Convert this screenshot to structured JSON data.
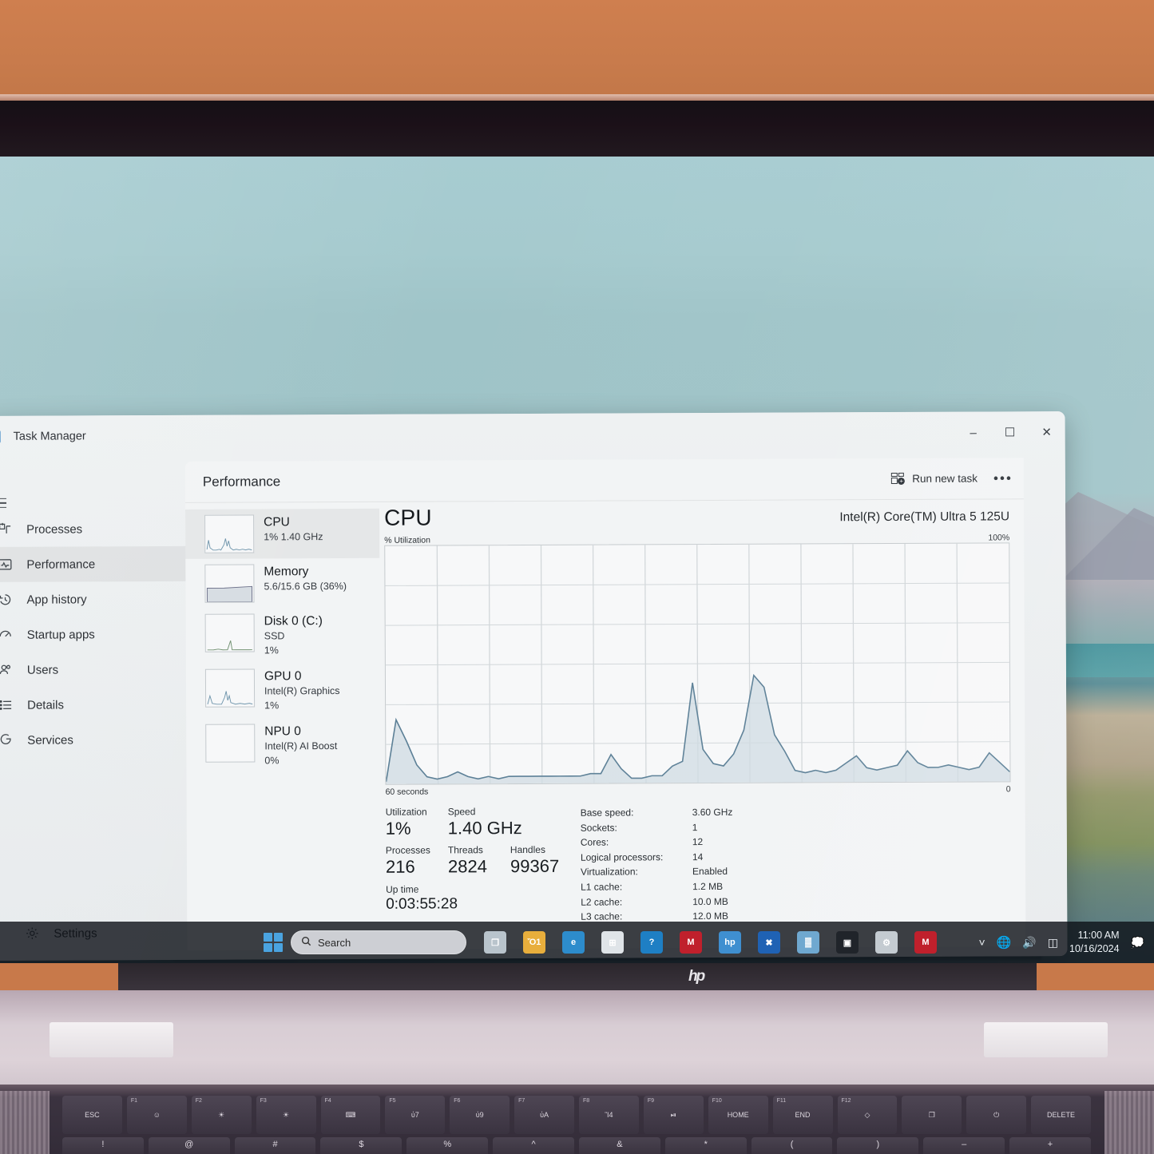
{
  "window": {
    "title": "Task Manager",
    "app_icon": "task-manager-icon",
    "minimize": "–",
    "maximize": "☐",
    "close": "✕"
  },
  "sidebar": {
    "hamburger": "menu-icon",
    "items": [
      {
        "label": "Processes",
        "icon": "processes-icon",
        "selected": false
      },
      {
        "label": "Performance",
        "icon": "performance-icon",
        "selected": true
      },
      {
        "label": "App history",
        "icon": "history-icon",
        "selected": false
      },
      {
        "label": "Startup apps",
        "icon": "startup-icon",
        "selected": false
      },
      {
        "label": "Users",
        "icon": "users-icon",
        "selected": false
      },
      {
        "label": "Details",
        "icon": "details-icon",
        "selected": false
      },
      {
        "label": "Services",
        "icon": "services-icon",
        "selected": false
      }
    ],
    "settings_label": "Settings",
    "settings_icon": "gear-icon"
  },
  "pane": {
    "title": "Performance",
    "run_new_task": "Run new task",
    "run_icon": "run-new-task-icon",
    "more_options": "•••"
  },
  "perf_list": [
    {
      "name": "CPU",
      "line1": "1%  1.40 GHz",
      "line2": "",
      "selected": true
    },
    {
      "name": "Memory",
      "line1": "5.6/15.6 GB (36%)",
      "line2": "",
      "selected": false
    },
    {
      "name": "Disk 0 (C:)",
      "line1": "SSD",
      "line2": "1%",
      "selected": false
    },
    {
      "name": "GPU 0",
      "line1": "Intel(R) Graphics",
      "line2": "1%",
      "selected": false
    },
    {
      "name": "NPU 0",
      "line1": "Intel(R) AI Boost",
      "line2": "0%",
      "selected": false
    }
  ],
  "detail": {
    "title": "CPU",
    "model": "Intel(R) Core(TM) Ultra 5 125U",
    "axis_y_label": "% Utilization",
    "axis_y_max": "100%",
    "axis_x_left": "60 seconds",
    "axis_x_right": "0",
    "stats": {
      "utilization_label": "Utilization",
      "utilization_value": "1%",
      "speed_label": "Speed",
      "speed_value": "1.40 GHz",
      "processes_label": "Processes",
      "processes_value": "216",
      "threads_label": "Threads",
      "threads_value": "2824",
      "handles_label": "Handles",
      "handles_value": "99367",
      "uptime_label": "Up time",
      "uptime_value": "0:03:55:28"
    },
    "specs": [
      {
        "key": "Base speed:",
        "value": "3.60 GHz"
      },
      {
        "key": "Sockets:",
        "value": "1"
      },
      {
        "key": "Cores:",
        "value": "12"
      },
      {
        "key": "Logical processors:",
        "value": "14"
      },
      {
        "key": "Virtualization:",
        "value": "Enabled"
      },
      {
        "key": "L1 cache:",
        "value": "1.2 MB"
      },
      {
        "key": "L2 cache:",
        "value": "10.0 MB"
      },
      {
        "key": "L3 cache:",
        "value": "12.0 MB"
      }
    ]
  },
  "chart_data": {
    "type": "area",
    "title": "CPU % Utilization",
    "xlabel": "60 seconds",
    "ylabel": "% Utilization",
    "ylim": [
      0,
      100
    ],
    "xlim": [
      60,
      0
    ],
    "grid": true,
    "legend": "none",
    "line_color": "#5b7f96",
    "fill_color": "#cfdbe2",
    "series": [
      {
        "name": "CPU utilization",
        "values": [
          1,
          27,
          18,
          8,
          3,
          2,
          3,
          5,
          3,
          2,
          3,
          2,
          3,
          3,
          3,
          3,
          3,
          3,
          3,
          3,
          4,
          4,
          12,
          6,
          2,
          2,
          3,
          3,
          7,
          9,
          42,
          14,
          8,
          7,
          12,
          22,
          45,
          40,
          20,
          13,
          5,
          4,
          5,
          4,
          5,
          8,
          11,
          6,
          5,
          6,
          7,
          13,
          8,
          6,
          6,
          7,
          6,
          5,
          6,
          12,
          8,
          4
        ]
      }
    ]
  },
  "taskbar": {
    "start_icon": "windows-start-icon",
    "search_icon": "search-icon",
    "search_placeholder": "Search",
    "icons": [
      {
        "name": "task-view-icon",
        "glyph": "❐",
        "color": "#b9c4cc"
      },
      {
        "name": "file-explorer-icon",
        "glyph": "Ὄ1",
        "color": "#e8ae3c"
      },
      {
        "name": "microsoft-edge-icon",
        "glyph": "e",
        "color": "#2d8ccc"
      },
      {
        "name": "microsoft-store-icon",
        "glyph": "⊞",
        "color": "#dfe4e8"
      },
      {
        "name": "help-icon",
        "glyph": "?",
        "color": "#1e7fc4"
      },
      {
        "name": "mcafee-icon",
        "glyph": "M",
        "color": "#c0202c"
      },
      {
        "name": "hp-app-icon",
        "glyph": "hp",
        "color": "#3f8fd0"
      },
      {
        "name": "hp-support-icon",
        "glyph": "✖",
        "color": "#1f62b4"
      },
      {
        "name": "task-manager-icon",
        "glyph": "▓",
        "color": "#6fa8d0"
      },
      {
        "name": "terminal-icon",
        "glyph": "▣",
        "color": "#20242a"
      },
      {
        "name": "settings-icon",
        "glyph": "⚙",
        "color": "#c4cbd1"
      },
      {
        "name": "mcafee-tray-icon",
        "glyph": "M",
        "color": "#c0202c"
      }
    ],
    "tray": [
      {
        "name": "show-hidden-icons",
        "glyph": "˄"
      },
      {
        "name": "network-icon",
        "glyph": "⊕"
      },
      {
        "name": "volume-icon",
        "glyph": "ὐA"
      },
      {
        "name": "battery-icon",
        "glyph": "▭"
      }
    ],
    "clock_time": "11:00 AM",
    "clock_date": "10/16/2024",
    "notification_icon": "notification-icon"
  },
  "laptop": {
    "brand": "hp",
    "fn_keys": [
      {
        "fn": "",
        "lbl": "ESC"
      },
      {
        "fn": "F1",
        "lbl": "☺"
      },
      {
        "fn": "F2",
        "lbl": "☀"
      },
      {
        "fn": "F3",
        "lbl": "☀"
      },
      {
        "fn": "F4",
        "lbl": "⌨"
      },
      {
        "fn": "F5",
        "lbl": "ὐ7"
      },
      {
        "fn": "F6",
        "lbl": "ὐ9"
      },
      {
        "fn": "F7",
        "lbl": "ὐA"
      },
      {
        "fn": "F8",
        "lbl": "Ἲ4"
      },
      {
        "fn": "F9",
        "lbl": "⏯"
      },
      {
        "fn": "F10",
        "lbl": "HOME"
      },
      {
        "fn": "F11",
        "lbl": "END"
      },
      {
        "fn": "F12",
        "lbl": "◇"
      },
      {
        "fn": "",
        "lbl": "❐"
      },
      {
        "fn": "",
        "lbl": "⏻"
      },
      {
        "fn": "",
        "lbl": "DELETE"
      }
    ],
    "number_row_symbols": [
      "!",
      "@",
      "#",
      "$",
      "%",
      "^",
      "&",
      "*",
      "(",
      ")",
      "–",
      "+"
    ]
  }
}
